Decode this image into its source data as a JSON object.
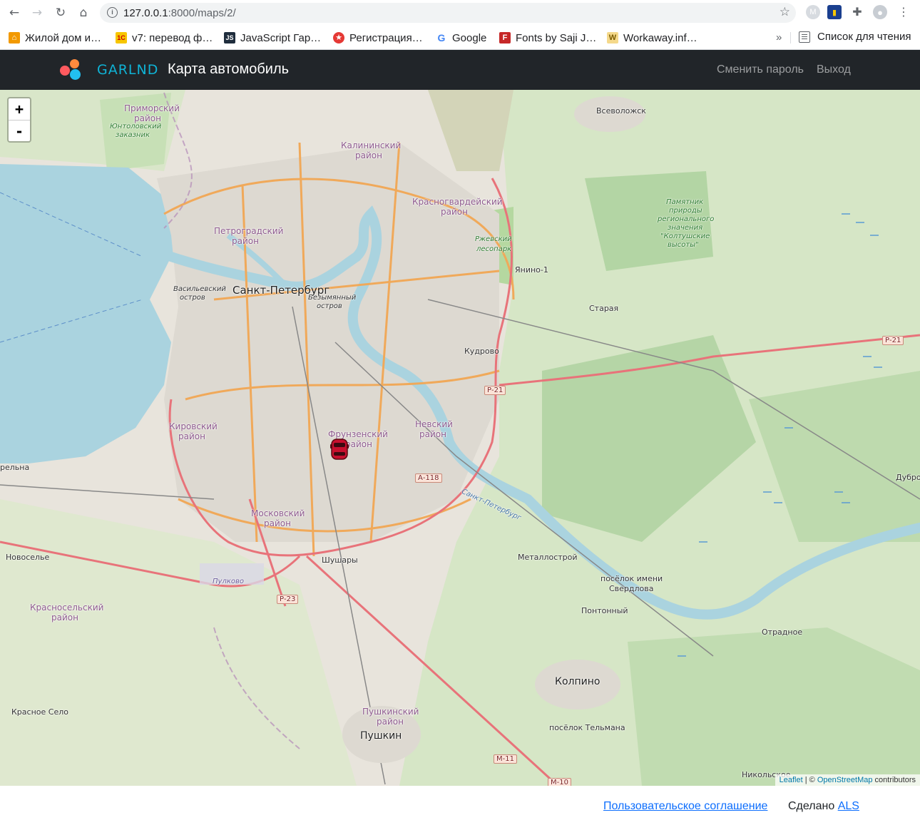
{
  "browser": {
    "url_host": "127.0.0.1",
    "url_rest": ":8000/maps/2/",
    "bookmarks": [
      {
        "label": "Жилой дом и…",
        "color": "#f29900",
        "glyph": "⌂"
      },
      {
        "label": "v7: перевод ф…",
        "color": "#f7c600",
        "glyph": "1C"
      },
      {
        "label": "JavaScript Гар…",
        "color": "#1f2d3d",
        "glyph": "JS"
      },
      {
        "label": "Регистрация…",
        "color": "#e53935",
        "glyph": "★"
      },
      {
        "label": "Google",
        "color": "#ffffff",
        "glyph": "G"
      },
      {
        "label": "Fonts by Saji J…",
        "color": "#c62828",
        "glyph": "F"
      },
      {
        "label": "Workaway.inf…",
        "color": "#f5d98b",
        "glyph": "W"
      }
    ],
    "bookmarks_more": "»",
    "reading_list": "Список для чтения"
  },
  "navbar": {
    "brand": "GARLND",
    "title": "Карта автомобиль",
    "links": [
      "Сменить пароль",
      "Выход"
    ]
  },
  "map": {
    "zoom_in": "+",
    "zoom_out": "-",
    "marker_icon": "car-icon",
    "labels": [
      {
        "text": "Приморский",
        "kind": "district"
      },
      {
        "text": "район",
        "kind": "district"
      },
      {
        "text": "Юнтоловский",
        "kind": "park"
      },
      {
        "text": "заказник",
        "kind": "park"
      },
      {
        "text": "Калининский",
        "kind": "district"
      },
      {
        "text": "район",
        "kind": "district"
      },
      {
        "text": "Всеволожск",
        "kind": "town"
      },
      {
        "text": "Красногвардейский",
        "kind": "district"
      },
      {
        "text": "район",
        "kind": "district"
      },
      {
        "text": "Петроградский",
        "kind": "district"
      },
      {
        "text": "район",
        "kind": "district"
      },
      {
        "text": "Ржевский",
        "kind": "park"
      },
      {
        "text": "лесопарк",
        "kind": "park"
      },
      {
        "text": "Памятник",
        "kind": "park"
      },
      {
        "text": "природы",
        "kind": "park"
      },
      {
        "text": "регионального",
        "kind": "park"
      },
      {
        "text": "значения",
        "kind": "park"
      },
      {
        "text": "\"Колтушские",
        "kind": "park"
      },
      {
        "text": "высоты\"",
        "kind": "park"
      },
      {
        "text": "Янино-1",
        "kind": "town"
      },
      {
        "text": "Васильевский",
        "kind": "island"
      },
      {
        "text": "остров",
        "kind": "island"
      },
      {
        "text": "Санкт-Петербург",
        "kind": "city"
      },
      {
        "text": "Безымянный",
        "kind": "island"
      },
      {
        "text": "остров",
        "kind": "island"
      },
      {
        "text": "Старая",
        "kind": "town"
      },
      {
        "text": "Кудрово",
        "kind": "town"
      },
      {
        "text": "Р-21",
        "kind": "shield"
      },
      {
        "text": "Р-21",
        "kind": "shield"
      },
      {
        "text": "Кировский",
        "kind": "district"
      },
      {
        "text": "район",
        "kind": "district"
      },
      {
        "text": "Фрунзенский",
        "kind": "district"
      },
      {
        "text": "район",
        "kind": "district"
      },
      {
        "text": "Невский",
        "kind": "district"
      },
      {
        "text": "район",
        "kind": "district"
      },
      {
        "text": "А-118",
        "kind": "shield"
      },
      {
        "text": "рельна",
        "kind": "town"
      },
      {
        "text": "Дубро",
        "kind": "town"
      },
      {
        "text": "Санкт-Петербург",
        "kind": "water"
      },
      {
        "text": "Московский",
        "kind": "district"
      },
      {
        "text": "район",
        "kind": "district"
      },
      {
        "text": "Новоселье",
        "kind": "town"
      },
      {
        "text": "Шушары",
        "kind": "town"
      },
      {
        "text": "Металлострой",
        "kind": "town"
      },
      {
        "text": "Пулково",
        "kind": "airport"
      },
      {
        "text": "посёлок имени",
        "kind": "town"
      },
      {
        "text": "Свердлова",
        "kind": "town"
      },
      {
        "text": "Р-23",
        "kind": "shield"
      },
      {
        "text": "Красносельский",
        "kind": "district"
      },
      {
        "text": "район",
        "kind": "district"
      },
      {
        "text": "Понтонный",
        "kind": "town"
      },
      {
        "text": "Отрадное",
        "kind": "town"
      },
      {
        "text": "Колпино",
        "kind": "city2"
      },
      {
        "text": "Красное Село",
        "kind": "town"
      },
      {
        "text": "Пушкинский",
        "kind": "district"
      },
      {
        "text": "район",
        "kind": "district"
      },
      {
        "text": "посёлок Тельмана",
        "kind": "town"
      },
      {
        "text": "Пушкин",
        "kind": "city2"
      },
      {
        "text": "М-11",
        "kind": "shield"
      },
      {
        "text": "Никольское",
        "kind": "town"
      },
      {
        "text": "М-10",
        "kind": "shield"
      }
    ],
    "attribution": {
      "leaflet": "Leaflet",
      "sep": " | © ",
      "osm": "OpenStreetMap",
      "tail": " contributors"
    }
  },
  "footer": {
    "agreement": "Пользовательское соглашение",
    "made_by": "Сделано",
    "author": "ALS"
  }
}
